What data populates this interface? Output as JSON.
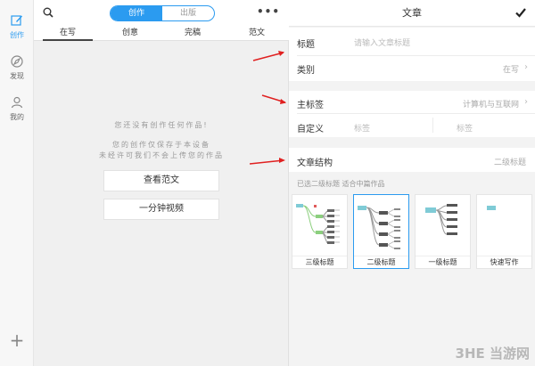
{
  "rail": {
    "items": [
      {
        "label": "创作",
        "icon": "pencil-icon"
      },
      {
        "label": "发现",
        "icon": "compass-icon"
      },
      {
        "label": "我的",
        "icon": "user-icon"
      }
    ],
    "add": "+"
  },
  "middle": {
    "segments": [
      "创作",
      "出版"
    ],
    "more": "•••",
    "tabs": [
      "在写",
      "创意",
      "完稿",
      "范文"
    ],
    "empty": {
      "line1": "您还没有创作任何作品!",
      "line2": "您的创作仅保存于本设备",
      "line3": "未经许可我们不会上传您的作品"
    },
    "buttons": {
      "view_samples": "查看范文",
      "video": "一分钟视频"
    }
  },
  "editor": {
    "title": "文章",
    "title_field": {
      "label": "标题",
      "placeholder": "请输入文章标题"
    },
    "category": {
      "label": "类别",
      "value": "在写"
    },
    "main_tag": {
      "label": "主标签",
      "value": "计算机与互联网"
    },
    "custom": {
      "label": "自定义",
      "tag1": "标签",
      "tag2": "标签"
    },
    "structure": {
      "label": "文章结构",
      "value": "二级标题"
    },
    "hint": "已选二级标题 适合中篇作品",
    "cards": [
      {
        "caption": "三级标题",
        "selected": false
      },
      {
        "caption": "二级标题",
        "selected": true
      },
      {
        "caption": "一级标题",
        "selected": false
      },
      {
        "caption": "快速写作",
        "selected": false
      }
    ]
  },
  "watermark": "3HE 当游网",
  "colors": {
    "accent": "#2b9bf0",
    "arrow": "#e02020"
  }
}
